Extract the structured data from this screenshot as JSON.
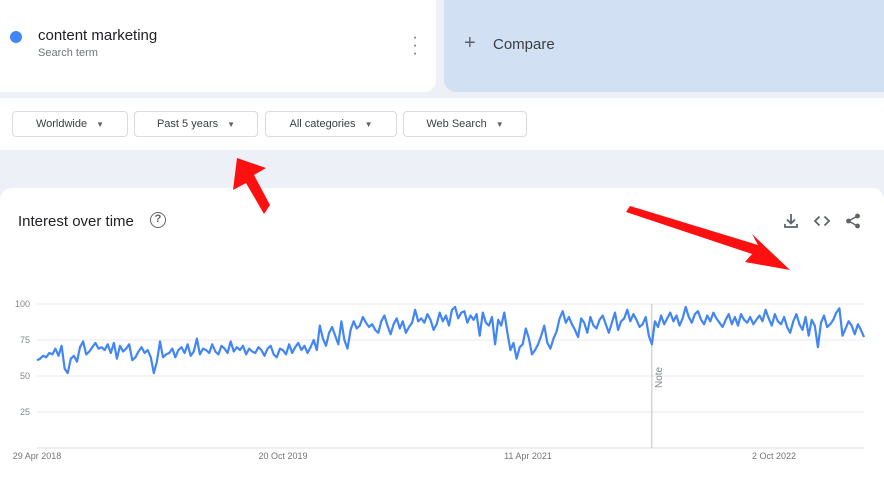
{
  "search_term": {
    "label": "content marketing",
    "sublabel": "Search term",
    "color": "#4285f4"
  },
  "compare": {
    "label": "Compare",
    "icon": "plus-icon"
  },
  "filters": [
    {
      "label": "Worldwide"
    },
    {
      "label": "Past 5 years"
    },
    {
      "label": "All categories"
    },
    {
      "label": "Web Search"
    }
  ],
  "chart_section": {
    "title": "Interest over time",
    "note_label": "Note",
    "icons": [
      "help-icon",
      "download-icon",
      "embed-icon",
      "share-icon"
    ]
  },
  "annotations": {
    "arrow_color": "#ff1010"
  },
  "chart_data": {
    "type": "line",
    "x_ticks": [
      "29 Apr 2018",
      "20 Oct 2019",
      "11 Apr 2021",
      "2 Oct 2022"
    ],
    "y_ticks": [
      25,
      50,
      75,
      100
    ],
    "ylim": [
      0,
      100
    ],
    "grid": true,
    "line_color": "#4285f4",
    "note_at_index": 200,
    "series": [
      {
        "values": [
          61,
          62,
          64,
          63,
          66,
          65,
          69,
          64,
          71,
          55,
          52,
          62,
          64,
          60,
          70,
          74,
          65,
          67,
          70,
          73,
          69,
          70,
          68,
          72,
          66,
          73,
          62,
          71,
          67,
          69,
          72,
          61,
          63,
          67,
          70,
          66,
          68,
          63,
          52,
          60,
          74,
          63,
          65,
          66,
          69,
          63,
          68,
          70,
          66,
          72,
          64,
          67,
          76,
          65,
          69,
          68,
          66,
          72,
          67,
          65,
          71,
          69,
          66,
          74,
          67,
          70,
          68,
          71,
          65,
          69,
          67,
          66,
          70,
          68,
          64,
          69,
          71,
          65,
          63,
          69,
          68,
          65,
          72,
          66,
          70,
          73,
          68,
          71,
          66,
          70,
          75,
          68,
          85,
          76,
          71,
          80,
          84,
          78,
          72,
          88,
          75,
          69,
          82,
          88,
          83,
          85,
          91,
          87,
          84,
          86,
          82,
          80,
          88,
          92,
          85,
          79,
          86,
          90,
          83,
          88,
          80,
          84,
          87,
          96,
          88,
          90,
          87,
          93,
          89,
          82,
          86,
          94,
          88,
          92,
          85,
          96,
          98,
          90,
          94,
          95,
          87,
          92,
          89,
          93,
          78,
          94,
          87,
          85,
          91,
          72,
          89,
          85,
          94,
          80,
          68,
          73,
          62,
          70,
          72,
          83,
          76,
          65,
          68,
          72,
          78,
          85,
          73,
          69,
          76,
          81,
          90,
          95,
          87,
          91,
          86,
          82,
          77,
          90,
          87,
          80,
          91,
          85,
          83,
          89,
          92,
          86,
          80,
          87,
          94,
          82,
          88,
          90,
          96,
          88,
          93,
          89,
          84,
          86,
          91,
          78,
          72,
          88,
          84,
          92,
          86,
          90,
          94,
          88,
          92,
          85,
          90,
          98,
          91,
          87,
          93,
          95,
          89,
          86,
          92,
          88,
          94,
          90,
          87,
          84,
          89,
          93,
          86,
          91,
          85,
          93,
          89,
          87,
          91,
          86,
          89,
          92,
          88,
          96,
          90,
          85,
          93,
          88,
          86,
          91,
          84,
          80,
          88,
          93,
          86,
          82,
          91,
          78,
          89,
          85,
          70,
          87,
          92,
          84,
          86,
          89,
          94,
          97,
          78,
          83,
          88,
          85,
          79,
          86,
          82,
          77
        ]
      }
    ]
  }
}
